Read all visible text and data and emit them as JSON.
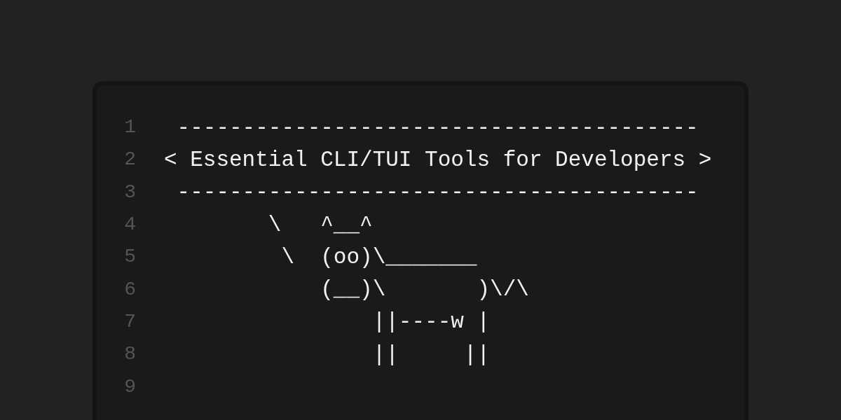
{
  "editor": {
    "lines": [
      {
        "number": "1",
        "text": " ----------------------------------------"
      },
      {
        "number": "2",
        "text": "< Essential CLI/TUI Tools for Developers >"
      },
      {
        "number": "3",
        "text": " ----------------------------------------"
      },
      {
        "number": "4",
        "text": "        \\   ^__^"
      },
      {
        "number": "5",
        "text": "         \\  (oo)\\_______"
      },
      {
        "number": "6",
        "text": "            (__)\\       )\\/\\"
      },
      {
        "number": "7",
        "text": "                ||----w |"
      },
      {
        "number": "8",
        "text": "                ||     ||"
      },
      {
        "number": "9"
      }
    ]
  }
}
